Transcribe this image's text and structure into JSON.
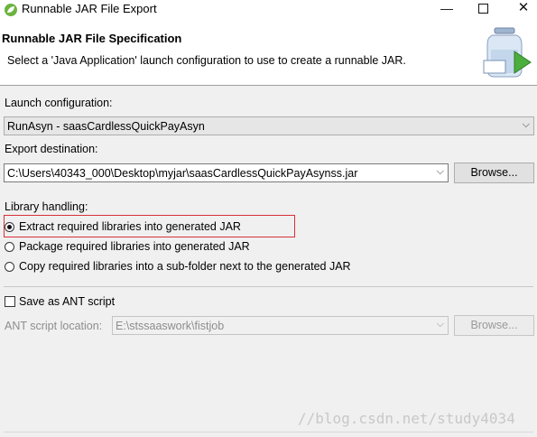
{
  "window": {
    "title": "Runnable JAR File Export",
    "minimize_glyph": "—",
    "close_glyph": "✕"
  },
  "banner": {
    "title": "Runnable JAR File Specification",
    "description": "Select a 'Java Application' launch configuration to use to create a runnable JAR."
  },
  "launch": {
    "label": "Launch configuration:",
    "value": "RunAsyn - saasCardlessQuickPayAsyn"
  },
  "export": {
    "label": "Export destination:",
    "value": "C:\\Users\\40343_000\\Desktop\\myjar\\saasCardlessQuickPayAsynss.jar",
    "browse_label": "Browse..."
  },
  "library": {
    "label": "Library handling:",
    "options": [
      {
        "label": "Extract required libraries into generated JAR",
        "selected": true
      },
      {
        "label": "Package required libraries into generated JAR",
        "selected": false
      },
      {
        "label": "Copy required libraries into a sub-folder next to the generated JAR",
        "selected": false
      }
    ]
  },
  "ant": {
    "checkbox_label": "Save as ANT script",
    "checked": false,
    "location_label": "ANT script location:",
    "location_value": "E:\\stssaaswork\\fistjob",
    "browse_label": "Browse..."
  },
  "dropdown_glyph": "⌵",
  "watermark": "//blog.csdn.net/study4034",
  "colors": {
    "highlight_border": "#d9313a",
    "app_icon": "#6db33f"
  }
}
